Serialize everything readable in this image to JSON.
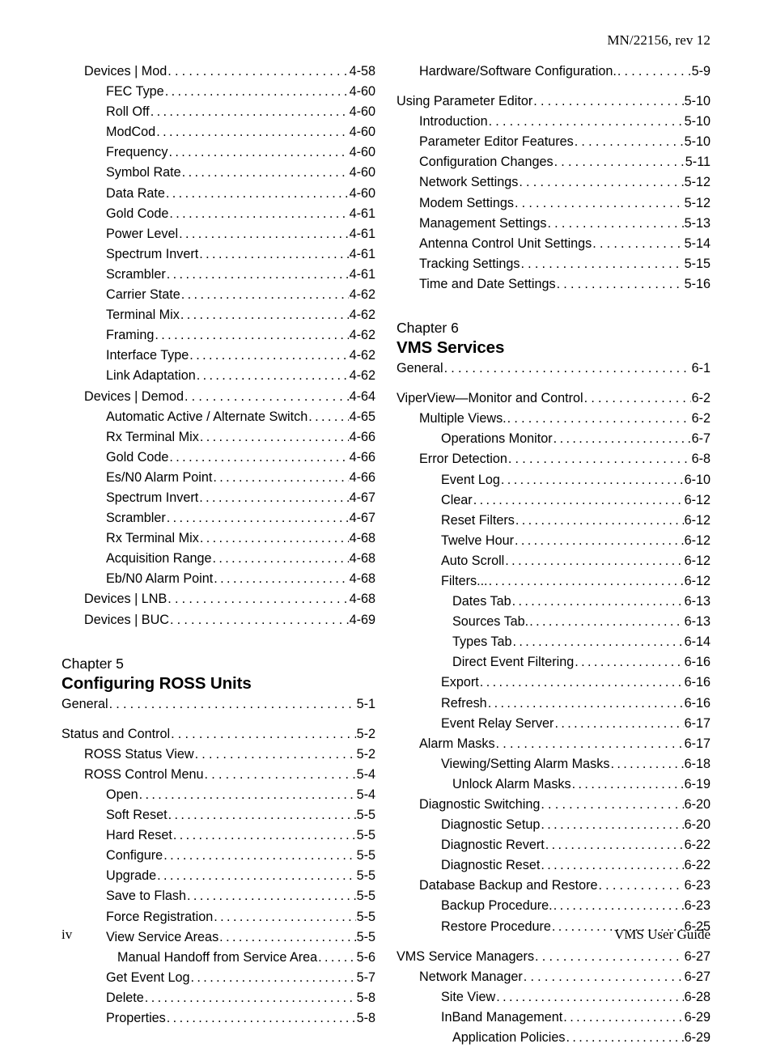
{
  "header": {
    "running_head": "MN/22156, rev 12"
  },
  "footer": {
    "folio": "iv",
    "doc_title": "VMS User Guide"
  },
  "leader": "........................................................................",
  "left_column": {
    "entries": [
      {
        "label": "Devices | Mod",
        "page": "4-58",
        "level": 1,
        "gap": false
      },
      {
        "label": "FEC Type",
        "page": "4-60",
        "level": 2,
        "gap": false
      },
      {
        "label": "Roll Off",
        "page": "4-60",
        "level": 2,
        "gap": false
      },
      {
        "label": "ModCod",
        "page": "4-60",
        "level": 2,
        "gap": false
      },
      {
        "label": "Frequency",
        "page": "4-60",
        "level": 2,
        "gap": false
      },
      {
        "label": "Symbol Rate",
        "page": "4-60",
        "level": 2,
        "gap": false
      },
      {
        "label": "Data Rate",
        "page": "4-60",
        "level": 2,
        "gap": false
      },
      {
        "label": "Gold Code",
        "page": "4-61",
        "level": 2,
        "gap": false
      },
      {
        "label": "Power Level",
        "page": "4-61",
        "level": 2,
        "gap": false
      },
      {
        "label": "Spectrum Invert",
        "page": "4-61",
        "level": 2,
        "gap": false
      },
      {
        "label": "Scrambler",
        "page": "4-61",
        "level": 2,
        "gap": false
      },
      {
        "label": "Carrier State",
        "page": "4-62",
        "level": 2,
        "gap": false
      },
      {
        "label": "Terminal Mix",
        "page": "4-62",
        "level": 2,
        "gap": false
      },
      {
        "label": "Framing",
        "page": "4-62",
        "level": 2,
        "gap": false
      },
      {
        "label": "Interface Type",
        "page": "4-62",
        "level": 2,
        "gap": false
      },
      {
        "label": "Link Adaptation",
        "page": "4-62",
        "level": 2,
        "gap": false
      },
      {
        "label": "Devices | Demod",
        "page": "4-64",
        "level": 1,
        "gap": false
      },
      {
        "label": "Automatic Active / Alternate Switch",
        "page": "4-65",
        "level": 2,
        "gap": false
      },
      {
        "label": "Rx Terminal Mix",
        "page": "4-66",
        "level": 2,
        "gap": false
      },
      {
        "label": "Gold Code",
        "page": "4-66",
        "level": 2,
        "gap": false
      },
      {
        "label": "Es/N0 Alarm Point",
        "page": "4-66",
        "level": 2,
        "gap": false
      },
      {
        "label": "Spectrum Invert",
        "page": "4-67",
        "level": 2,
        "gap": false
      },
      {
        "label": "Scrambler",
        "page": "4-67",
        "level": 2,
        "gap": false
      },
      {
        "label": "Rx Terminal Mix",
        "page": "4-68",
        "level": 2,
        "gap": false
      },
      {
        "label": "Acquisition Range",
        "page": "4-68",
        "level": 2,
        "gap": false
      },
      {
        "label": "Eb/N0 Alarm Point",
        "page": "4-68",
        "level": 2,
        "gap": false
      },
      {
        "label": "Devices | LNB",
        "page": "4-68",
        "level": 1,
        "gap": false
      },
      {
        "label": "Devices | BUC",
        "page": "4-69",
        "level": 1,
        "gap": false
      }
    ],
    "chapter": {
      "number": "Chapter 5",
      "title": "Configuring ROSS Units"
    },
    "chapter_entries": [
      {
        "label": "General",
        "page": "5-1",
        "level": 0,
        "gap": false
      },
      {
        "label": "Status and Control",
        "page": "5-2",
        "level": 0,
        "gap": true
      },
      {
        "label": "ROSS Status View",
        "page": "5-2",
        "level": 1,
        "gap": false
      },
      {
        "label": "ROSS Control Menu",
        "page": "5-4",
        "level": 1,
        "gap": false
      },
      {
        "label": "Open",
        "page": "5-4",
        "level": 2,
        "gap": false
      },
      {
        "label": "Soft Reset",
        "page": "5-5",
        "level": 2,
        "gap": false
      },
      {
        "label": "Hard Reset",
        "page": "5-5",
        "level": 2,
        "gap": false
      },
      {
        "label": "Configure",
        "page": "5-5",
        "level": 2,
        "gap": false
      },
      {
        "label": "Upgrade",
        "page": "5-5",
        "level": 2,
        "gap": false
      },
      {
        "label": "Save to Flash",
        "page": "5-5",
        "level": 2,
        "gap": false
      },
      {
        "label": "Force Registration",
        "page": "5-5",
        "level": 2,
        "gap": false
      },
      {
        "label": "View Service Areas",
        "page": "5-5",
        "level": 2,
        "gap": false
      },
      {
        "label": "Manual Handoff from Service Area",
        "page": "5-6",
        "level": 3,
        "gap": false
      },
      {
        "label": "Get Event Log",
        "page": "5-7",
        "level": 2,
        "gap": false
      },
      {
        "label": "Delete",
        "page": "5-8",
        "level": 2,
        "gap": false
      },
      {
        "label": "Properties",
        "page": "5-8",
        "level": 2,
        "gap": false
      }
    ]
  },
  "right_column": {
    "entries": [
      {
        "label": "Hardware/Software Configuration.",
        "page": "5-9",
        "level": 1,
        "gap": false
      },
      {
        "label": "Using Parameter Editor",
        "page": "5-10",
        "level": 0,
        "gap": true
      },
      {
        "label": "Introduction",
        "page": "5-10",
        "level": 1,
        "gap": false
      },
      {
        "label": "Parameter Editor Features",
        "page": "5-10",
        "level": 1,
        "gap": false
      },
      {
        "label": "Configuration Changes",
        "page": "5-11",
        "level": 1,
        "gap": false
      },
      {
        "label": "Network Settings",
        "page": "5-12",
        "level": 1,
        "gap": false
      },
      {
        "label": "Modem Settings",
        "page": "5-12",
        "level": 1,
        "gap": false
      },
      {
        "label": "Management Settings",
        "page": "5-13",
        "level": 1,
        "gap": false
      },
      {
        "label": "Antenna Control Unit Settings",
        "page": "5-14",
        "level": 1,
        "gap": false
      },
      {
        "label": "Tracking Settings",
        "page": "5-15",
        "level": 1,
        "gap": false
      },
      {
        "label": "Time and Date Settings",
        "page": "5-16",
        "level": 1,
        "gap": false
      }
    ],
    "chapter": {
      "number": "Chapter 6",
      "title": "VMS Services"
    },
    "chapter_entries": [
      {
        "label": "General",
        "page": "6-1",
        "level": 0,
        "gap": false
      },
      {
        "label": "ViperView—Monitor and Control",
        "page": "6-2",
        "level": 0,
        "gap": true
      },
      {
        "label": "Multiple Views.",
        "page": "6-2",
        "level": 1,
        "gap": false
      },
      {
        "label": "Operations Monitor",
        "page": "6-7",
        "level": 2,
        "gap": false
      },
      {
        "label": "Error Detection",
        "page": "6-8",
        "level": 1,
        "gap": false
      },
      {
        "label": "Event Log",
        "page": "6-10",
        "level": 2,
        "gap": false
      },
      {
        "label": "Clear",
        "page": "6-12",
        "level": 2,
        "gap": false
      },
      {
        "label": "Reset Filters",
        "page": "6-12",
        "level": 2,
        "gap": false
      },
      {
        "label": "Twelve Hour",
        "page": "6-12",
        "level": 2,
        "gap": false
      },
      {
        "label": "Auto Scroll",
        "page": "6-12",
        "level": 2,
        "gap": false
      },
      {
        "label": "Filters...",
        "page": "6-12",
        "level": 2,
        "gap": false
      },
      {
        "label": "Dates Tab",
        "page": "6-13",
        "level": 3,
        "gap": false
      },
      {
        "label": "Sources Tab.",
        "page": "6-13",
        "level": 3,
        "gap": false
      },
      {
        "label": "Types Tab",
        "page": "6-14",
        "level": 3,
        "gap": false
      },
      {
        "label": "Direct Event Filtering",
        "page": "6-16",
        "level": 3,
        "gap": false
      },
      {
        "label": "Export",
        "page": "6-16",
        "level": 2,
        "gap": false
      },
      {
        "label": "Refresh",
        "page": "6-16",
        "level": 2,
        "gap": false
      },
      {
        "label": "Event Relay Server",
        "page": "6-17",
        "level": 2,
        "gap": false
      },
      {
        "label": "Alarm Masks",
        "page": "6-17",
        "level": 1,
        "gap": false
      },
      {
        "label": "Viewing/Setting Alarm Masks",
        "page": "6-18",
        "level": 2,
        "gap": false
      },
      {
        "label": "Unlock Alarm Masks",
        "page": "6-19",
        "level": 3,
        "gap": false
      },
      {
        "label": "Diagnostic Switching",
        "page": "6-20",
        "level": 1,
        "gap": false
      },
      {
        "label": "Diagnostic Setup",
        "page": "6-20",
        "level": 2,
        "gap": false
      },
      {
        "label": "Diagnostic Revert",
        "page": "6-22",
        "level": 2,
        "gap": false
      },
      {
        "label": "Diagnostic Reset",
        "page": "6-22",
        "level": 2,
        "gap": false
      },
      {
        "label": "Database Backup and Restore",
        "page": "6-23",
        "level": 1,
        "gap": false
      },
      {
        "label": "Backup Procedure.",
        "page": "6-23",
        "level": 2,
        "gap": false
      },
      {
        "label": "Restore Procedure",
        "page": "6-25",
        "level": 2,
        "gap": false
      },
      {
        "label": "VMS Service Managers",
        "page": "6-27",
        "level": 0,
        "gap": true
      },
      {
        "label": "Network Manager",
        "page": "6-27",
        "level": 1,
        "gap": false
      },
      {
        "label": "Site View",
        "page": "6-28",
        "level": 2,
        "gap": false
      },
      {
        "label": "InBand Management",
        "page": "6-29",
        "level": 2,
        "gap": false
      },
      {
        "label": "Application Policies",
        "page": "6-29",
        "level": 3,
        "gap": false
      }
    ]
  }
}
